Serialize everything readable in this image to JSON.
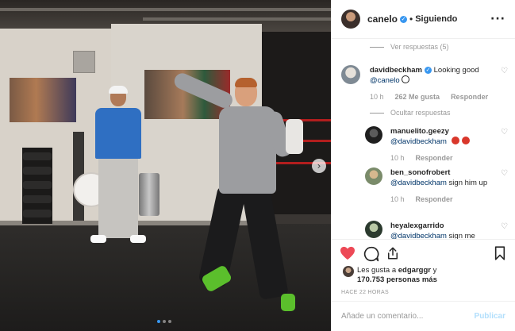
{
  "post": {
    "author": "canelo",
    "follow_status": "Siguiendo",
    "separator": "•",
    "more_icon": "ellipsis-icon"
  },
  "comments": {
    "view_replies": "Ver respuestas (5)",
    "main": {
      "user": "davidbeckham",
      "text": "Looking good",
      "mention": "@canelo",
      "emoji": "soccer-ball-emoji",
      "time": "10 h",
      "likes": "262 Me gusta",
      "reply": "Responder"
    },
    "hide_replies": "Ocultar respuestas",
    "replies": [
      {
        "user": "manuelito.geezy",
        "mention": "@davidbeckham",
        "text": "",
        "time": "10 h",
        "reply": "Responder"
      },
      {
        "user": "ben_sonofrobert",
        "mention": "@davidbeckham",
        "text": "sign him up",
        "time": "10 h",
        "reply": "Responder"
      },
      {
        "user": "heyalexgarrido",
        "mention": "@davidbeckham",
        "text": "sign me"
      }
    ]
  },
  "likes": {
    "prefix": "Les gusta a",
    "user": "edgarggr",
    "conjunction": "y",
    "others": "170.753 personas más"
  },
  "time_ago": "HACE 22 HORAS",
  "add_comment": {
    "placeholder": "Añade un comentario...",
    "publish": "Publicar"
  },
  "carousel": {
    "total": 3,
    "active": 1
  },
  "colors": {
    "like_red": "#ed4956",
    "verified_blue": "#3897f0",
    "accent": "#3897f0"
  }
}
